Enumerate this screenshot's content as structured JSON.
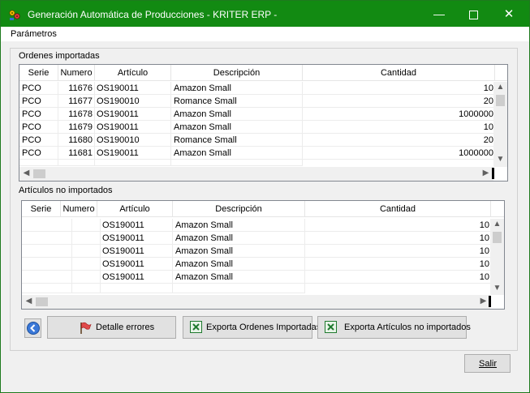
{
  "window": {
    "title": "Generación Automática de Producciones - KRITER ERP -",
    "minimize_icon": "minimize-icon",
    "maximize_icon": "maximize-icon",
    "close_icon": "close-icon"
  },
  "menu": {
    "parametros": "Parámetros"
  },
  "imported": {
    "group_label": "Ordenes importadas",
    "columns": [
      "Serie",
      "Numero",
      "Artículo",
      "Descripción",
      "Cantidad"
    ],
    "rows": [
      [
        "PCO",
        "11676",
        "OS190011",
        "Amazon Small",
        "10"
      ],
      [
        "PCO",
        "11677",
        "OS190010",
        "Romance Small",
        "20"
      ],
      [
        "PCO",
        "11678",
        "OS190011",
        "Amazon Small",
        "1000000"
      ],
      [
        "PCO",
        "11679",
        "OS190011",
        "Amazon Small",
        "10"
      ],
      [
        "PCO",
        "11680",
        "OS190010",
        "Romance Small",
        "20"
      ],
      [
        "PCO",
        "11681",
        "OS190011",
        "Amazon Small",
        "1000000"
      ]
    ]
  },
  "not_imported": {
    "group_label": "Artículos no importados",
    "columns": [
      "Serie",
      "Numero",
      "Artículo",
      "Descripción",
      "Cantidad"
    ],
    "rows": [
      [
        "",
        "",
        "OS190011",
        "Amazon Small",
        "10"
      ],
      [
        "",
        "",
        "OS190011",
        "Amazon Small",
        "10"
      ],
      [
        "",
        "",
        "OS190011",
        "Amazon Small",
        "10"
      ],
      [
        "",
        "",
        "OS190011",
        "Amazon Small",
        "10"
      ],
      [
        "",
        "",
        "OS190011",
        "Amazon Small",
        "10"
      ]
    ]
  },
  "buttons": {
    "detalle_errores": "Detalle errores",
    "exporta_ordenes": "Exporta Ordenes Importadas",
    "exporta_articulos": "Exporta Artículos no importados",
    "salir": "Salir"
  },
  "colors": {
    "titlebar": "#128a12",
    "accent": "#1e7a1e"
  }
}
